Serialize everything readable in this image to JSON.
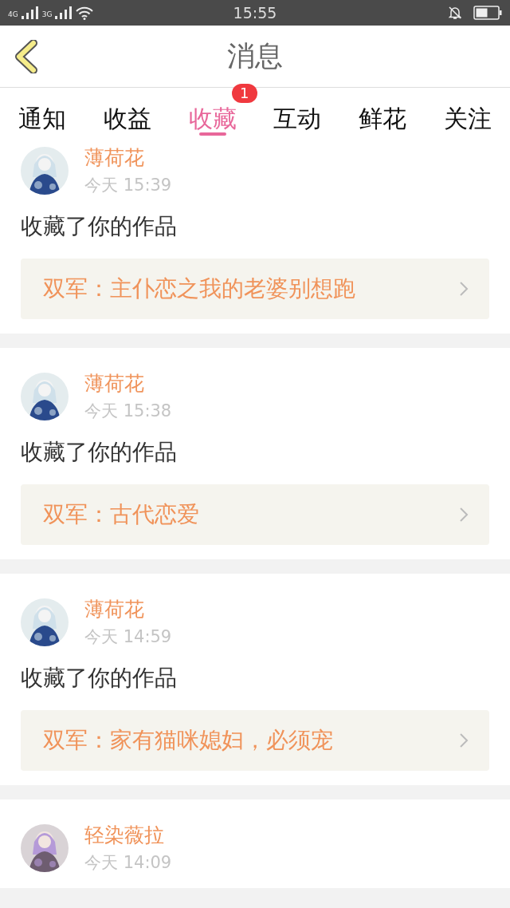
{
  "status_bar": {
    "network_1": "4G",
    "network_2": "3G",
    "time": "15:55"
  },
  "header": {
    "title": "消息"
  },
  "tabs": [
    {
      "label": "通知",
      "selected": false
    },
    {
      "label": "收益",
      "selected": false
    },
    {
      "label": "收藏",
      "selected": true,
      "badge": "1"
    },
    {
      "label": "互动",
      "selected": false
    },
    {
      "label": "鲜花",
      "selected": false
    },
    {
      "label": "关注",
      "selected": false
    }
  ],
  "messages": [
    {
      "user": "薄荷花",
      "time": "今天 15:39",
      "action": "收藏了你的作品",
      "work": "双军：主仆恋之我的老婆别想跑"
    },
    {
      "user": "薄荷花",
      "time": "今天 15:38",
      "action": "收藏了你的作品",
      "work": "双军：古代恋爱"
    },
    {
      "user": "薄荷花",
      "time": "今天 14:59",
      "action": "收藏了你的作品",
      "work": "双军：家有猫咪媳妇，必须宠"
    },
    {
      "user": "轻染薇拉",
      "time": "今天 14:09"
    }
  ]
}
